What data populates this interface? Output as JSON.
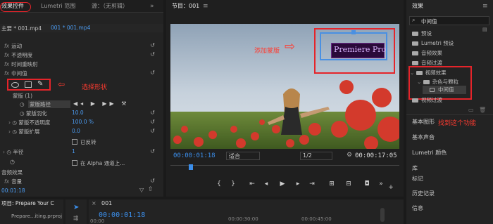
{
  "left_panel": {
    "tabs": [
      "效果控件",
      "Lumetri 范围",
      "源：（无剪辑）"
    ],
    "clip_left": "主要 * 001.mp4",
    "clip_right": "001 * 001.mp4",
    "section_video": "视频效果",
    "rows": {
      "motion": "运动",
      "opacity": "不透明度",
      "time_remap": "时间重映射",
      "middle_value": "中间值",
      "mask_group": "蒙版 (1)",
      "mask_path": "蒙版路径",
      "mask_feather": "蒙版羽化",
      "mask_feather_val": "10.0",
      "mask_opacity": "蒙版不透明度",
      "mask_opacity_val": "100.0 %",
      "mask_expand": "蒙版扩展",
      "mask_expand_val": "0.0",
      "inverted": "已反转",
      "radius": "半径",
      "radius_val": "1",
      "alpha": "在 Alpha 通道上...",
      "section_audio": "音频效果",
      "volume": "音量"
    },
    "timecode": "00:01:18",
    "annotation": "选择形状"
  },
  "program": {
    "title": "节目：001",
    "timecode_left": "00:00:01:18",
    "fit": "适合",
    "fraction": "1/2",
    "timecode_right": "00:00:17:05",
    "overlay_text": "Premiere Pro",
    "annotation": "添加蒙版"
  },
  "right_panel": {
    "title": "效果",
    "search_value": "中间值",
    "tree": [
      "预设",
      "Lumetri 预设",
      "音频效果",
      "音频过渡",
      "视频效果",
      "杂色与颗粒",
      "中间值",
      "视频过渡"
    ],
    "sections": [
      "基本图形",
      "基本声音",
      "Lumetri 颜色",
      "库",
      "标记",
      "历史记录",
      "信息"
    ],
    "annotation": "找到这个功能"
  },
  "bottom": {
    "project_tab": "项目: Prepare Your C",
    "project_file": "Prepare...iting.prproj",
    "seq_tab": "001",
    "seq_timecode": "00:00:01:18",
    "ruler_left": "00:00",
    "ruler_mid": "00:00:30:00",
    "ruler_right": "00:00:45:00"
  }
}
